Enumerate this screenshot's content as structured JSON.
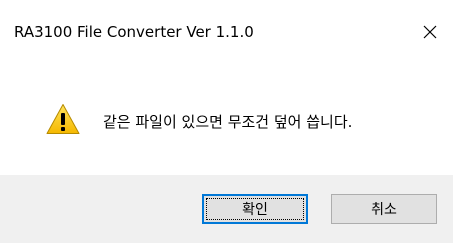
{
  "window": {
    "title": "RA3100 File Converter Ver 1.1.0",
    "close_icon": "close-icon"
  },
  "content": {
    "icon": "warning-icon",
    "message": "같은 파일이 있으면 무조건 덮어 씁니다."
  },
  "buttons": {
    "ok_label": "확인",
    "cancel_label": "취소"
  },
  "colors": {
    "warning_fill": "#ffd200",
    "focus_border": "#0078d7",
    "footer_background": "#f0f0f0"
  }
}
